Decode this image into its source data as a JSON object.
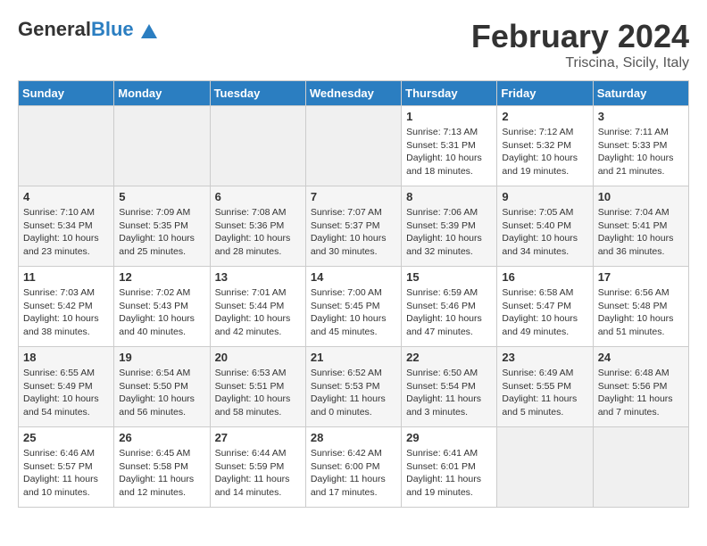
{
  "header": {
    "logo_general": "General",
    "logo_blue": "Blue",
    "month_title": "February 2024",
    "location": "Triscina, Sicily, Italy"
  },
  "days_of_week": [
    "Sunday",
    "Monday",
    "Tuesday",
    "Wednesday",
    "Thursday",
    "Friday",
    "Saturday"
  ],
  "weeks": [
    {
      "days": [
        {
          "num": "",
          "info": ""
        },
        {
          "num": "",
          "info": ""
        },
        {
          "num": "",
          "info": ""
        },
        {
          "num": "",
          "info": ""
        },
        {
          "num": "1",
          "info": "Sunrise: 7:13 AM\nSunset: 5:31 PM\nDaylight: 10 hours and 18 minutes."
        },
        {
          "num": "2",
          "info": "Sunrise: 7:12 AM\nSunset: 5:32 PM\nDaylight: 10 hours and 19 minutes."
        },
        {
          "num": "3",
          "info": "Sunrise: 7:11 AM\nSunset: 5:33 PM\nDaylight: 10 hours and 21 minutes."
        }
      ]
    },
    {
      "days": [
        {
          "num": "4",
          "info": "Sunrise: 7:10 AM\nSunset: 5:34 PM\nDaylight: 10 hours and 23 minutes."
        },
        {
          "num": "5",
          "info": "Sunrise: 7:09 AM\nSunset: 5:35 PM\nDaylight: 10 hours and 25 minutes."
        },
        {
          "num": "6",
          "info": "Sunrise: 7:08 AM\nSunset: 5:36 PM\nDaylight: 10 hours and 28 minutes."
        },
        {
          "num": "7",
          "info": "Sunrise: 7:07 AM\nSunset: 5:37 PM\nDaylight: 10 hours and 30 minutes."
        },
        {
          "num": "8",
          "info": "Sunrise: 7:06 AM\nSunset: 5:39 PM\nDaylight: 10 hours and 32 minutes."
        },
        {
          "num": "9",
          "info": "Sunrise: 7:05 AM\nSunset: 5:40 PM\nDaylight: 10 hours and 34 minutes."
        },
        {
          "num": "10",
          "info": "Sunrise: 7:04 AM\nSunset: 5:41 PM\nDaylight: 10 hours and 36 minutes."
        }
      ]
    },
    {
      "days": [
        {
          "num": "11",
          "info": "Sunrise: 7:03 AM\nSunset: 5:42 PM\nDaylight: 10 hours and 38 minutes."
        },
        {
          "num": "12",
          "info": "Sunrise: 7:02 AM\nSunset: 5:43 PM\nDaylight: 10 hours and 40 minutes."
        },
        {
          "num": "13",
          "info": "Sunrise: 7:01 AM\nSunset: 5:44 PM\nDaylight: 10 hours and 42 minutes."
        },
        {
          "num": "14",
          "info": "Sunrise: 7:00 AM\nSunset: 5:45 PM\nDaylight: 10 hours and 45 minutes."
        },
        {
          "num": "15",
          "info": "Sunrise: 6:59 AM\nSunset: 5:46 PM\nDaylight: 10 hours and 47 minutes."
        },
        {
          "num": "16",
          "info": "Sunrise: 6:58 AM\nSunset: 5:47 PM\nDaylight: 10 hours and 49 minutes."
        },
        {
          "num": "17",
          "info": "Sunrise: 6:56 AM\nSunset: 5:48 PM\nDaylight: 10 hours and 51 minutes."
        }
      ]
    },
    {
      "days": [
        {
          "num": "18",
          "info": "Sunrise: 6:55 AM\nSunset: 5:49 PM\nDaylight: 10 hours and 54 minutes."
        },
        {
          "num": "19",
          "info": "Sunrise: 6:54 AM\nSunset: 5:50 PM\nDaylight: 10 hours and 56 minutes."
        },
        {
          "num": "20",
          "info": "Sunrise: 6:53 AM\nSunset: 5:51 PM\nDaylight: 10 hours and 58 minutes."
        },
        {
          "num": "21",
          "info": "Sunrise: 6:52 AM\nSunset: 5:53 PM\nDaylight: 11 hours and 0 minutes."
        },
        {
          "num": "22",
          "info": "Sunrise: 6:50 AM\nSunset: 5:54 PM\nDaylight: 11 hours and 3 minutes."
        },
        {
          "num": "23",
          "info": "Sunrise: 6:49 AM\nSunset: 5:55 PM\nDaylight: 11 hours and 5 minutes."
        },
        {
          "num": "24",
          "info": "Sunrise: 6:48 AM\nSunset: 5:56 PM\nDaylight: 11 hours and 7 minutes."
        }
      ]
    },
    {
      "days": [
        {
          "num": "25",
          "info": "Sunrise: 6:46 AM\nSunset: 5:57 PM\nDaylight: 11 hours and 10 minutes."
        },
        {
          "num": "26",
          "info": "Sunrise: 6:45 AM\nSunset: 5:58 PM\nDaylight: 11 hours and 12 minutes."
        },
        {
          "num": "27",
          "info": "Sunrise: 6:44 AM\nSunset: 5:59 PM\nDaylight: 11 hours and 14 minutes."
        },
        {
          "num": "28",
          "info": "Sunrise: 6:42 AM\nSunset: 6:00 PM\nDaylight: 11 hours and 17 minutes."
        },
        {
          "num": "29",
          "info": "Sunrise: 6:41 AM\nSunset: 6:01 PM\nDaylight: 11 hours and 19 minutes."
        },
        {
          "num": "",
          "info": ""
        },
        {
          "num": "",
          "info": ""
        }
      ]
    }
  ]
}
